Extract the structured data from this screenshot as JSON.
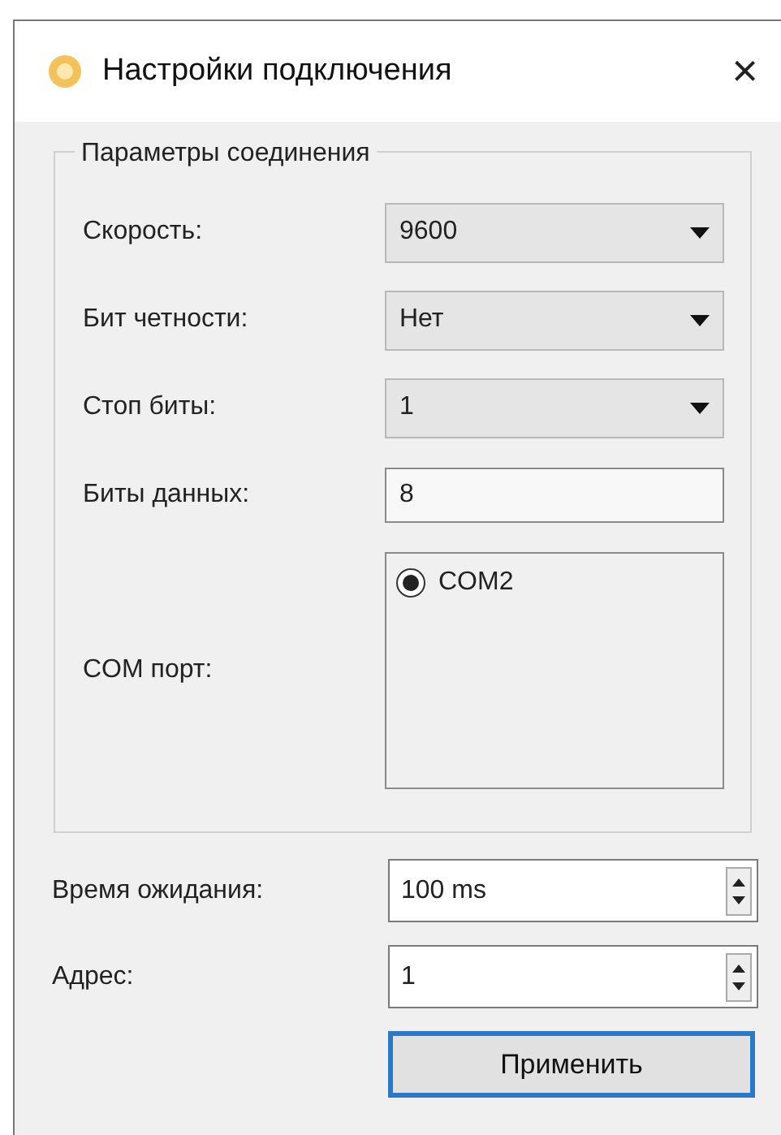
{
  "window": {
    "title": "Настройки подключения",
    "close": "×"
  },
  "group": {
    "title": "Параметры соединения",
    "rows": [
      {
        "label": "Скорость:",
        "kind": "dropdown",
        "value": "9600"
      },
      {
        "label": "Бит четности:",
        "kind": "dropdown",
        "value": "Нет"
      },
      {
        "label": "Стоп биты:",
        "kind": "dropdown",
        "value": "1"
      },
      {
        "label": "Биты данных:",
        "kind": "field",
        "value": "8"
      },
      {
        "label": "COM порт:",
        "kind": "radio_list",
        "options": [
          {
            "label": "COM2",
            "selected": true
          }
        ]
      }
    ]
  },
  "spinboxes": [
    {
      "label": "Время ожидания:",
      "value": "100 ms"
    },
    {
      "label": "Адрес:",
      "value": "1"
    }
  ],
  "button": {
    "label": "Применить",
    "focused": true
  }
}
